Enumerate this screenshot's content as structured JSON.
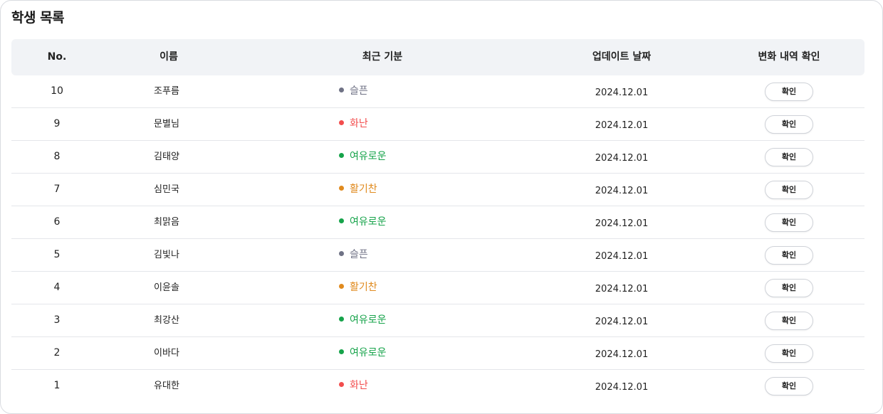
{
  "title": "학생 목록",
  "headers": {
    "no": "No.",
    "name": "이름",
    "mood": "최근 기분",
    "date": "업데이트 날짜",
    "history": "변화 내역 확인"
  },
  "colors": {
    "gray": "#6f7285",
    "red": "#f24d4d",
    "green": "#16a34a",
    "orange": "#e08a1e"
  },
  "rows": [
    {
      "no": "10",
      "name": "조푸름",
      "mood": "슬픈",
      "mood_color": "gray",
      "date": "2024.12.01",
      "button": "확인"
    },
    {
      "no": "9",
      "name": "문별님",
      "mood": "화난",
      "mood_color": "red",
      "date": "2024.12.01",
      "button": "확인"
    },
    {
      "no": "8",
      "name": "김태양",
      "mood": "여유로운",
      "mood_color": "green",
      "date": "2024.12.01",
      "button": "확인"
    },
    {
      "no": "7",
      "name": "심민국",
      "mood": "활기찬",
      "mood_color": "orange",
      "date": "2024.12.01",
      "button": "확인"
    },
    {
      "no": "6",
      "name": "최맑음",
      "mood": "여유로운",
      "mood_color": "green",
      "date": "2024.12.01",
      "button": "확인"
    },
    {
      "no": "5",
      "name": "김빛나",
      "mood": "슬픈",
      "mood_color": "gray",
      "date": "2024.12.01",
      "button": "확인"
    },
    {
      "no": "4",
      "name": "이윤솔",
      "mood": "활기찬",
      "mood_color": "orange",
      "date": "2024.12.01",
      "button": "확인"
    },
    {
      "no": "3",
      "name": "최강산",
      "mood": "여유로운",
      "mood_color": "green",
      "date": "2024.12.01",
      "button": "확인"
    },
    {
      "no": "2",
      "name": "이바다",
      "mood": "여유로운",
      "mood_color": "green",
      "date": "2024.12.01",
      "button": "확인"
    },
    {
      "no": "1",
      "name": "유대한",
      "mood": "화난",
      "mood_color": "red",
      "date": "2024.12.01",
      "button": "확인"
    }
  ]
}
